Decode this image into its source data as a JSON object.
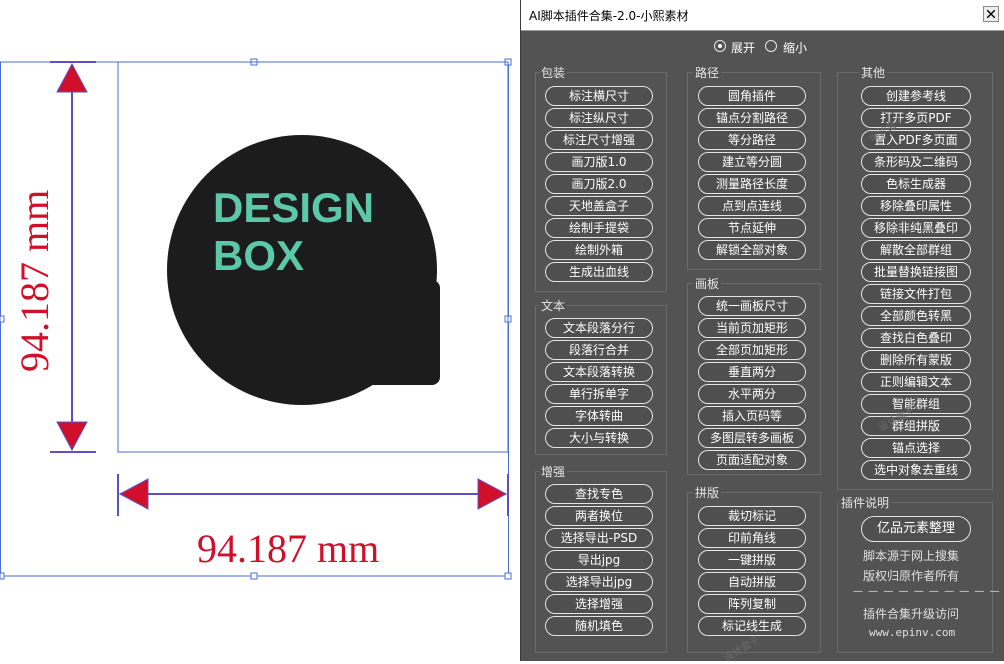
{
  "artboard": {
    "logo_line1": "DESIGN",
    "logo_line2": "BOX",
    "height_dimension": "94.187 mm",
    "width_dimension": "94.187 mm",
    "colors": {
      "circle": "#1c1c1c",
      "logo_text": "#5cc8a8",
      "dimension": "#d0102a",
      "arrow_line": "#5b50c8",
      "selection": "#4a6cd8"
    }
  },
  "window": {
    "title": "AI脚本插件合集-2.0-小熙素材",
    "close_icon": "close-icon",
    "mode": {
      "expand_label": "展开",
      "collapse_label": "缩小",
      "selected": "expand"
    }
  },
  "groups": {
    "packaging": {
      "title": "包装",
      "buttons": [
        "标注横尺寸",
        "标注纵尺寸",
        "标注尺寸增强",
        "画刀版1.0",
        "画刀版2.0",
        "天地盖盒子",
        "绘制手提袋",
        "绘制外箱",
        "生成出血线"
      ]
    },
    "text": {
      "title": "文本",
      "buttons": [
        "文本段落分行",
        "段落行合并",
        "文本段落转换",
        "单行拆单字",
        "字体转曲",
        "大小与转换"
      ]
    },
    "enhance": {
      "title": "增强",
      "buttons": [
        "查找专色",
        "两者换位",
        "选择导出-PSD",
        "导出jpg",
        "选择导出jpg",
        "选择增强",
        "随机填色"
      ]
    },
    "path": {
      "title": "路径",
      "buttons": [
        "圆角插件",
        "锚点分割路径",
        "等分路径",
        "建立等分圆",
        "测量路径长度",
        "点到点连线",
        "节点延伸",
        "解锁全部对象"
      ]
    },
    "artboard_group": {
      "title": "画板",
      "buttons": [
        "统一画板尺寸",
        "当前页加矩形",
        "全部页加矩形",
        "垂直两分",
        "水平两分",
        "插入页码等",
        "多图层转多画板",
        "页面适配对象"
      ]
    },
    "imposition": {
      "title": "拼版",
      "buttons": [
        "裁切标记",
        "印前角线",
        "一键拼版",
        "自动拼版",
        "阵列复制",
        "标记线生成"
      ]
    },
    "other": {
      "title": "其他",
      "buttons": [
        "创建参考线",
        "打开多页PDF",
        "置入PDF多页面",
        "条形码及二维码",
        "色标生成器",
        "移除叠印属性",
        "移除非纯黑叠印",
        "解散全部群组",
        "批量替换链接图",
        "链接文件打包",
        "全部颜色转黑",
        "查找白色叠印",
        "删除所有蒙版",
        "正则编辑文本",
        "智能群组",
        "群组拼版",
        "锚点选择",
        "选中对象去重线"
      ]
    },
    "plugin_info": {
      "title": "插件说明",
      "main_button": "亿品元素整理",
      "line1": "脚本源于网上搜集",
      "line2": "版权归原作者所有",
      "divider": "— — — — — — — — — —",
      "line3": "插件合集升级访问",
      "url": "www.epinv.com"
    }
  },
  "watermark_text": "设计盒子"
}
